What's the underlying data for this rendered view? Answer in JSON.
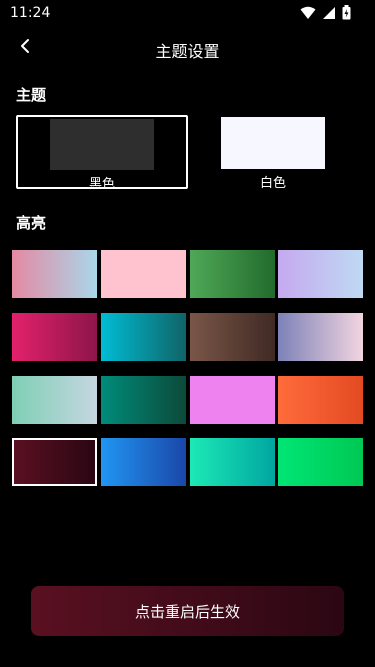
{
  "status_bar": {
    "time": "11:24",
    "icons": [
      "wifi-icon",
      "signal-icon",
      "battery-icon"
    ]
  },
  "header": {
    "back_icon": "chevron-left-icon",
    "title": "主题设置"
  },
  "theme_section": {
    "label": "主题",
    "options": [
      {
        "label": "黑色",
        "color": "#2e2e2e",
        "selected": true
      },
      {
        "label": "白色",
        "color": "#f7f8ff",
        "selected": false
      }
    ]
  },
  "highlight_section": {
    "label": "高亮",
    "swatches": [
      {
        "from": "#e48aa2",
        "to": "#a9d6ea",
        "selected": false
      },
      {
        "from": "#ffc3d0",
        "to": "#ffc3d0",
        "selected": false
      },
      {
        "from": "#4fa857",
        "to": "#226b2c",
        "selected": false
      },
      {
        "from": "#c5a9ef",
        "to": "#bfd9f3",
        "selected": false
      },
      {
        "from": "#e3216b",
        "to": "#8e1549",
        "selected": false
      },
      {
        "from": "#00bcd4",
        "to": "#0f6467",
        "selected": false
      },
      {
        "from": "#7a5647",
        "to": "#3f2a24",
        "selected": false
      },
      {
        "from": "#7d82b8",
        "to": "#f2d5e0",
        "selected": false
      },
      {
        "from": "#7ecfb4",
        "to": "#c6d6e1",
        "selected": false
      },
      {
        "from": "#008c7a",
        "to": "#0c4a3a",
        "selected": false
      },
      {
        "from": "#ee82ee",
        "to": "#ee82ee",
        "selected": false
      },
      {
        "from": "#ff6b3b",
        "to": "#e44a22",
        "selected": false
      },
      {
        "from": "#5a1021",
        "to": "#2b0613",
        "selected": true
      },
      {
        "from": "#2196f3",
        "to": "#1a47a8",
        "selected": false
      },
      {
        "from": "#1de9b6",
        "to": "#00a6a0",
        "selected": false
      },
      {
        "from": "#00e676",
        "to": "#00c853",
        "selected": false
      }
    ]
  },
  "restart_button": {
    "label": "点击重启后生效"
  }
}
